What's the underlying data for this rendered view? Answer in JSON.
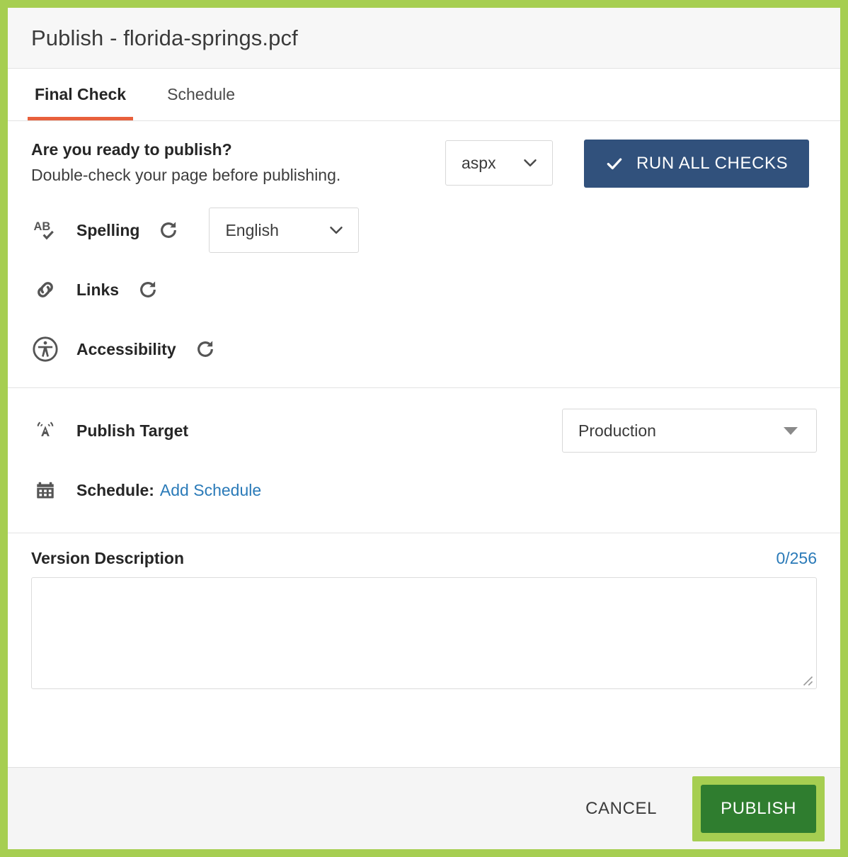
{
  "window": {
    "title": "Publish - florida-springs.pcf",
    "accent_border_color": "#a6ce51"
  },
  "tabs": [
    {
      "label": "Final Check",
      "active": true,
      "underline_color": "#e8603c"
    },
    {
      "label": "Schedule",
      "active": false
    }
  ],
  "ready": {
    "heading": "Are you ready to publish?",
    "subtext": "Double-check your page before publishing.",
    "format_select": {
      "value": "aspx",
      "icon": "chevron-down-icon"
    },
    "run_all_button": {
      "label": "RUN ALL CHECKS",
      "icon": "check-icon",
      "bg_color": "#31517c",
      "text_color": "#ffffff"
    }
  },
  "checks": [
    {
      "label": "Spelling",
      "icon": "spellcheck-icon",
      "refresh_icon": "refresh-icon",
      "language_select": {
        "value": "English",
        "icon": "chevron-down-icon"
      }
    },
    {
      "label": "Links",
      "icon": "link-icon",
      "refresh_icon": "refresh-icon"
    },
    {
      "label": "Accessibility",
      "icon": "accessibility-icon",
      "refresh_icon": "refresh-icon"
    }
  ],
  "target": {
    "label": "Publish Target",
    "icon": "broadcast-icon",
    "select": {
      "value": "Production",
      "icon": "caret-down-icon"
    },
    "schedule_label": "Schedule:",
    "schedule_link": "Add Schedule",
    "schedule_icon": "calendar-icon",
    "link_color": "#2a7ab8"
  },
  "version_description": {
    "title": "Version Description",
    "counter": "0/256",
    "counter_color": "#2a7ab8",
    "value": "",
    "placeholder": ""
  },
  "footer": {
    "cancel_label": "CANCEL",
    "publish_label": "PUBLISH",
    "publish_bg_color": "#2f7d2f",
    "publish_focus_ring_color": "#a6ce51"
  }
}
